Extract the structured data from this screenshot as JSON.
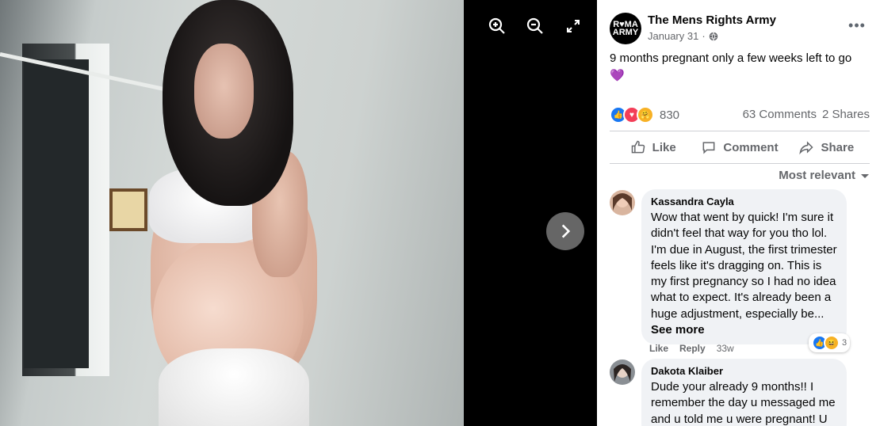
{
  "viewer": {
    "controls": {
      "zoom_in": "zoom-in-icon",
      "zoom_out": "zoom-out-icon",
      "fullscreen": "fullscreen-icon",
      "next": "chevron-right-icon"
    }
  },
  "post": {
    "page_name": "The Mens Rights Army",
    "avatar_text": "R♥MA ARMY",
    "date": "January 31",
    "separator": "·",
    "text": "9 months pregnant only a few weeks left to go",
    "emoji": "💜",
    "reaction_count": "830",
    "comments_count": "63 Comments",
    "shares_count": "2 Shares",
    "more_label": "•••"
  },
  "actions": {
    "like": "Like",
    "comment": "Comment",
    "share": "Share"
  },
  "sort_label": "Most relevant",
  "comments": [
    {
      "name": "Kassandra Cayla",
      "text": "Wow that went by quick! I'm sure it didn't feel that way for you tho lol. I'm due in August, the first trimester feels like it's dragging on. This is my first pregnancy so I had no idea what to expect. It's already been a huge adjustment, especially be...",
      "see_more": "See more",
      "like": "Like",
      "reply": "Reply",
      "time": "33w",
      "reaction_count": "3"
    },
    {
      "name": "Dakota Klaiber",
      "text": "Dude your already 9 months!! I remember the day u messaged me and u told me u were pregnant! U"
    }
  ],
  "colors": {
    "facebook_blue": "#1877f2",
    "love_red": "#f33e58",
    "care_yellow": "#f7b125",
    "secondary_text": "#65676b",
    "bubble_bg": "#f0f2f5"
  }
}
